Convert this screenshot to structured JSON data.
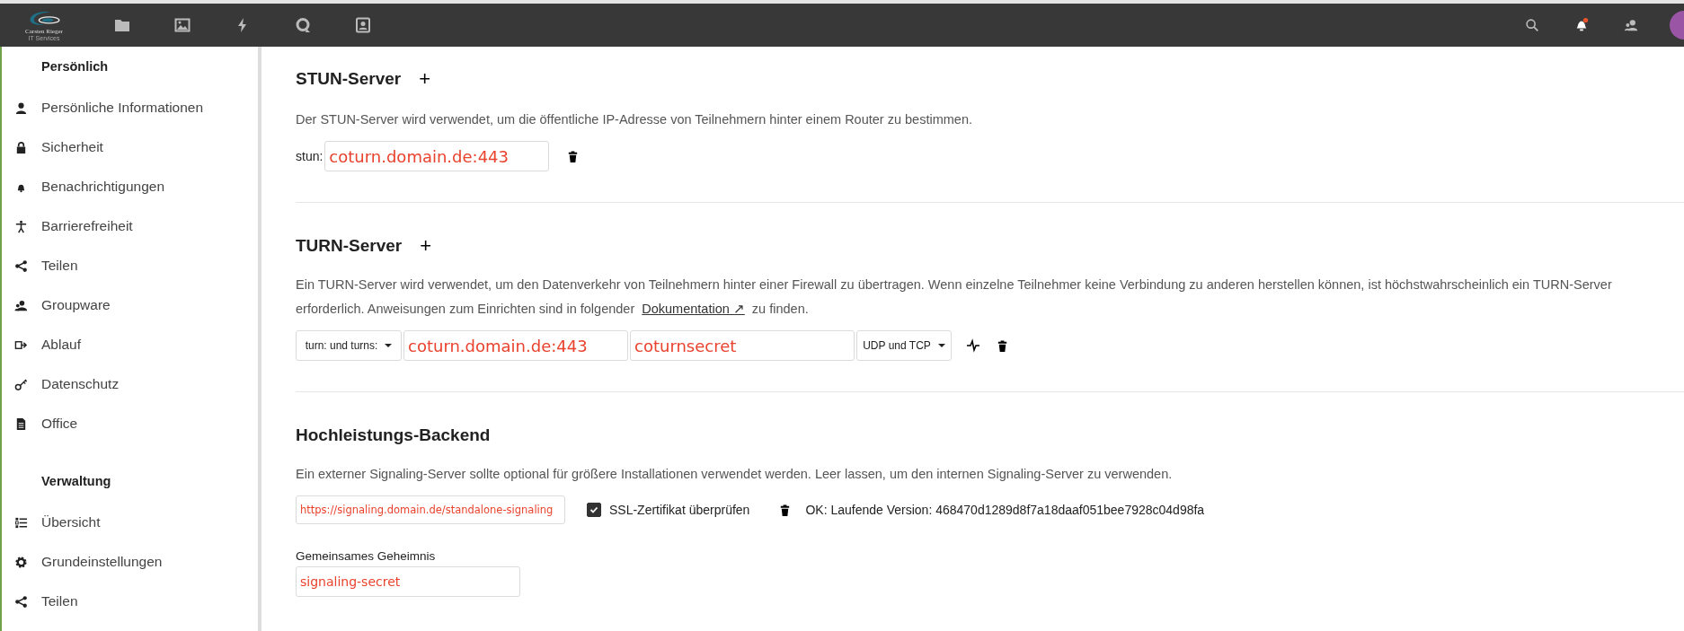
{
  "header": {
    "logo": {
      "name": "Carsten Rieger",
      "tagline": "IT Services"
    },
    "apps": [
      {
        "kind": "folder"
      },
      {
        "kind": "image"
      },
      {
        "kind": "bolt"
      },
      {
        "kind": "talk"
      },
      {
        "kind": "contact"
      }
    ],
    "actions": [
      {
        "kind": "search"
      },
      {
        "kind": "bell"
      },
      {
        "kind": "contacts"
      },
      {
        "kind": "avatar"
      }
    ]
  },
  "sidebar": {
    "sections": [
      {
        "title": "Persönlich",
        "items": [
          {
            "label": "Persönliche Informationen",
            "kind": "person"
          },
          {
            "label": "Sicherheit",
            "kind": "lock"
          },
          {
            "label": "Benachrichtigungen",
            "kind": "bell"
          },
          {
            "label": "Barrierefreiheit",
            "kind": "accessibility"
          },
          {
            "label": "Teilen",
            "kind": "share"
          },
          {
            "label": "Groupware",
            "kind": "group"
          },
          {
            "label": "Ablauf",
            "kind": "flow"
          },
          {
            "label": "Datenschutz",
            "kind": "key"
          },
          {
            "label": "Office",
            "kind": "document"
          }
        ]
      },
      {
        "title": "Verwaltung",
        "items": [
          {
            "label": "Übersicht",
            "kind": "list"
          },
          {
            "label": "Grundeinstellungen",
            "kind": "gear"
          },
          {
            "label": "Teilen",
            "kind": "share"
          }
        ]
      }
    ]
  },
  "stun": {
    "title": "STUN-Server",
    "add": "+",
    "description": "Der STUN-Server wird verwendet, um die öffentliche IP-Adresse von Teilnehmern hinter einem Router zu bestimmen.",
    "servers": [
      {
        "prefix": "stun:",
        "value": "coturn.domain.de:443"
      }
    ]
  },
  "turn": {
    "title": "TURN-Server",
    "add": "+",
    "description_before": "Ein TURN-Server wird verwendet, um den Datenverkehr von Teilnehmern hinter einer Firewall zu übertragen. Wenn einzelne Teilnehmer keine Verbindung zu anderen herstellen können, ist höchstwahrscheinlich ein TURN-Server erforderlich. Anweisungen zum Einrichten sind in folgender",
    "link": "Dokumentation ↗",
    "description_after": "zu finden.",
    "servers": [
      {
        "scheme": "turn: und turns:",
        "server": "coturn.domain.de:443",
        "secret": "coturnsecret",
        "protocols": "UDP und TCP"
      }
    ]
  },
  "backend": {
    "title": "Hochleistungs-Backend",
    "description": "Ein externer Signaling-Server sollte optional für größere Installationen verwendet werden. Leer lassen, um den internen Signaling-Server zu verwenden.",
    "servers": [
      {
        "url": "https://signaling.domain.de/standalone-signaling",
        "verify_ssl": true,
        "ssl_label": "SSL-Zertifikat überprüfen",
        "status": "OK: Laufende Version: 468470d1289d8f7a18daaf051bee7928c04d98fa"
      }
    ],
    "secret_label": "Gemeinsames Geheimnis",
    "secret_value": "signaling-secret"
  }
}
